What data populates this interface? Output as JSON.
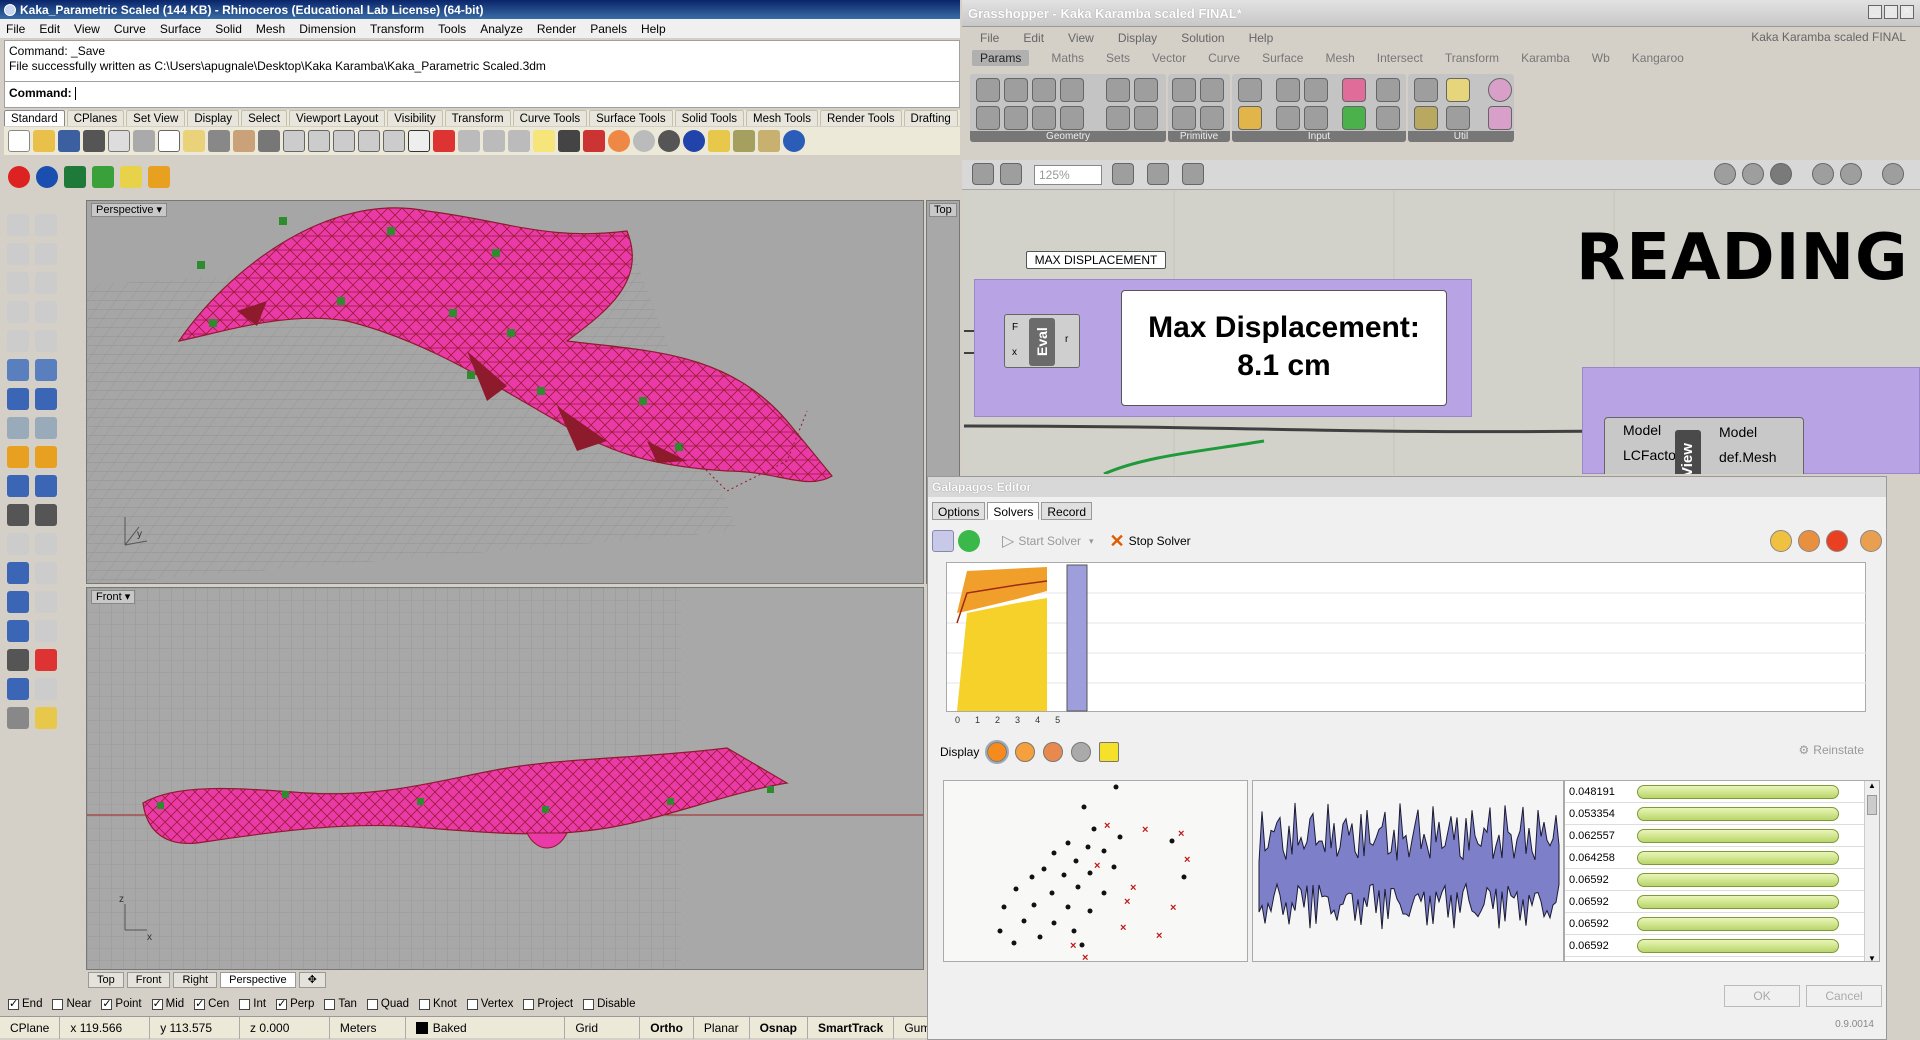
{
  "rhino": {
    "title": "Kaka_Parametric Scaled (144 KB) - Rhinoceros (Educational Lab License) (64-bit)",
    "menu": [
      "File",
      "Edit",
      "View",
      "Curve",
      "Surface",
      "Solid",
      "Mesh",
      "Dimension",
      "Transform",
      "Tools",
      "Analyze",
      "Render",
      "Panels",
      "Help"
    ],
    "history": [
      "Command: _Save",
      "File successfully written as C:\\Users\\apugnale\\Desktop\\Kaka Karamba\\Kaka_Parametric Scaled.3dm"
    ],
    "command_prompt": "Command:",
    "toolbar_tabs": [
      "Standard",
      "CPlanes",
      "Set View",
      "Display",
      "Select",
      "Viewport Layout",
      "Visibility",
      "Transform",
      "Curve Tools",
      "Surface Tools",
      "Solid Tools",
      "Mesh Tools",
      "Render Tools",
      "Drafting"
    ],
    "viewports": {
      "perspective": "Perspective",
      "top": "Top",
      "front": "Front"
    },
    "viewport_tabs": [
      "Top",
      "Front",
      "Right",
      "Perspective"
    ],
    "osnaps": [
      {
        "label": "End",
        "checked": true
      },
      {
        "label": "Near",
        "checked": false
      },
      {
        "label": "Point",
        "checked": true
      },
      {
        "label": "Mid",
        "checked": true
      },
      {
        "label": "Cen",
        "checked": true
      },
      {
        "label": "Int",
        "checked": false
      },
      {
        "label": "Perp",
        "checked": true
      },
      {
        "label": "Tan",
        "checked": false
      },
      {
        "label": "Quad",
        "checked": false
      },
      {
        "label": "Knot",
        "checked": false
      },
      {
        "label": "Vertex",
        "checked": false
      },
      {
        "label": "Project",
        "checked": false
      },
      {
        "label": "Disable",
        "checked": false
      }
    ],
    "status": {
      "cplane": "CPlane",
      "x": "x 119.566",
      "y": "y 113.575",
      "z": "z 0.000",
      "units": "Meters",
      "layer": "Baked",
      "grid_snap": "Grid Snap",
      "ortho": "Ortho",
      "planar": "Planar",
      "osnap": "Osnap",
      "smarttrack": "SmartTrack",
      "gumball": "Gumball"
    },
    "axes": {
      "x": "x",
      "y": "y",
      "z": "z"
    }
  },
  "gh": {
    "title": "Grasshopper - Kaka Karamba scaled FINAL*",
    "menu": [
      "File",
      "Edit",
      "View",
      "Display",
      "Solution",
      "Help"
    ],
    "doc_name": "Kaka Karamba scaled FINAL",
    "tabs": [
      "Params",
      "Maths",
      "Sets",
      "Vector",
      "Curve",
      "Surface",
      "Mesh",
      "Intersect",
      "Transform",
      "Karamba",
      "Wb",
      "Kangaroo"
    ],
    "groups": [
      "Geometry",
      "Primitive",
      "Input",
      "Util"
    ],
    "zoom": "125%",
    "reading": "READING",
    "bubble": "MAX DISPLACEMENT",
    "panel_lines": [
      "Max Displacement:",
      "8.1 cm"
    ],
    "eval": {
      "label": "Eval",
      "in_f": "F",
      "in_x": "x",
      "out_r": "r"
    },
    "view": {
      "label": "View",
      "in_model": "Model",
      "in_lcfactor": "LCFactor",
      "out_model": "Model",
      "out_defmesh": "def.Mesh"
    }
  },
  "galapagos": {
    "title": "Galapagos Editor",
    "tabs": [
      "Options",
      "Solvers",
      "Record"
    ],
    "start_solver": "Start Solver",
    "stop_solver": "Stop Solver",
    "graph_ticks": [
      "0",
      "1",
      "2",
      "3",
      "4",
      "5"
    ],
    "display_label": "Display",
    "reinstate": "Reinstate",
    "fitness_values": [
      "0.048191",
      "0.053354",
      "0.062557",
      "0.064258",
      "0.06592",
      "0.06592",
      "0.06592",
      "0.06592"
    ],
    "ok": "OK",
    "cancel": "Cancel",
    "version": "0.9.0014"
  },
  "colors": {
    "rhino_title": "#0a246a",
    "purple_group": "#b8a3e4",
    "mesh_pink": "#ea3aa8",
    "mesh_dark": "#8e1b2b",
    "fitness_bar": "#b9d66a"
  }
}
